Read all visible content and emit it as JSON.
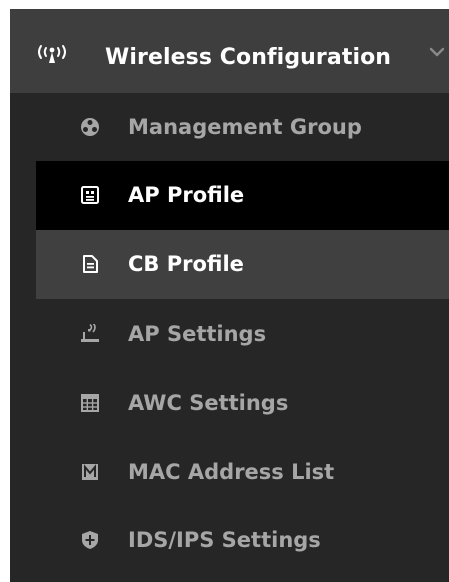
{
  "menu": {
    "header": {
      "label": "Wireless Configuration",
      "icon": "wireless-signal-icon",
      "expand_icon": "chevron-down-icon"
    },
    "items": [
      {
        "label": "Management Group",
        "icon": "group-icon",
        "state": "normal"
      },
      {
        "label": "AP Profile",
        "icon": "profile-icon",
        "state": "active"
      },
      {
        "label": "CB Profile",
        "icon": "document-icon",
        "state": "hover"
      },
      {
        "label": "AP Settings",
        "icon": "access-point-icon",
        "state": "normal"
      },
      {
        "label": "AWC Settings",
        "icon": "grid-icon",
        "state": "normal"
      },
      {
        "label": "MAC Address List",
        "icon": "list-icon",
        "state": "normal"
      },
      {
        "label": "IDS/IPS Settings",
        "icon": "shield-icon",
        "state": "normal"
      }
    ]
  },
  "colors": {
    "menu_bg": "#262626",
    "header_bg": "#3e3e3e",
    "active_bg": "#000000",
    "hover_bg": "#404040",
    "text_inactive": "#a6a6a6",
    "text_active": "#ffffff"
  }
}
